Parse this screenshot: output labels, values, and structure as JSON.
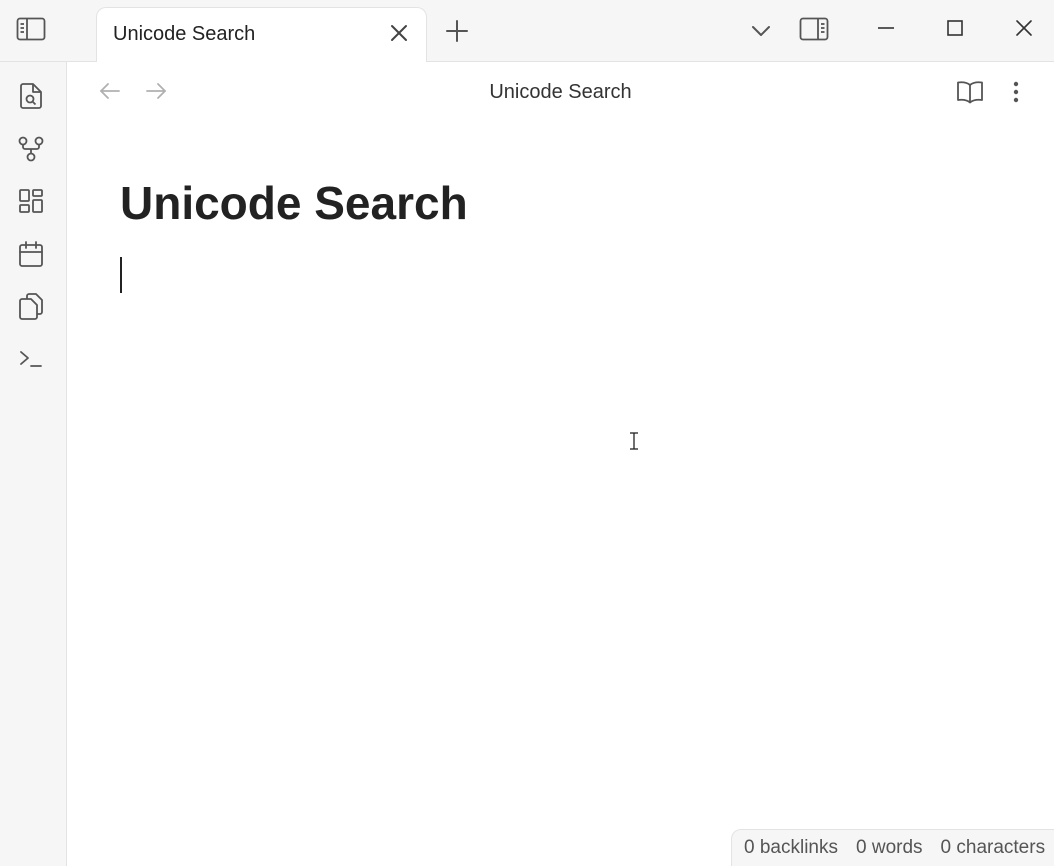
{
  "titlebar": {
    "tab_title": "Unicode Search"
  },
  "view": {
    "header_title": "Unicode Search",
    "note_title": "Unicode Search"
  },
  "statusbar": {
    "backlinks": "0 backlinks",
    "words": "0 words",
    "characters": "0 characters"
  },
  "icons": {
    "left": "sidebar-toggle-icon",
    "tab_close": "close-icon",
    "new_tab": "plus-icon",
    "tab_list": "chevron-down-icon",
    "right_sidebar": "right-sidebar-toggle-icon",
    "minimize": "minimize-icon",
    "maximize": "maximize-icon",
    "close_window": "close-icon",
    "ribbon": [
      "search-file-icon",
      "graph-icon",
      "dashboard-icon",
      "calendar-icon",
      "copy-icon",
      "terminal-icon"
    ],
    "back": "arrow-left-icon",
    "forward": "arrow-right-icon",
    "reading_view": "book-open-icon",
    "more_options": "more-vertical-icon"
  },
  "colors": {
    "chrome_bg": "#f6f6f6",
    "border": "#e3e3e3",
    "text": "#222222",
    "muted_icon": "#b0b0b0"
  }
}
